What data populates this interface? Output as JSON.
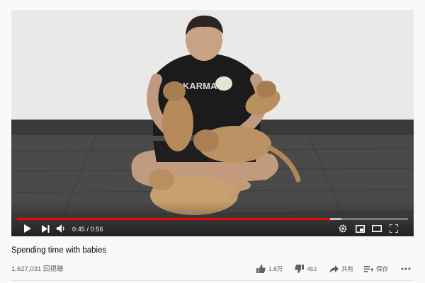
{
  "video": {
    "current_time": "0:45",
    "duration": "0:56",
    "time_separator": "/",
    "progress_fraction": 0.8,
    "buffer_fraction": 0.83,
    "accent_color": "#ff0000"
  },
  "info": {
    "title": "Spending time with babies",
    "views": "1,627,031 回視聴"
  },
  "actions": {
    "like_count": "1.8万",
    "dislike_count": "452",
    "share_label": "共有",
    "save_label": "保存"
  },
  "icons": [
    "play-icon",
    "next-icon",
    "volume-icon",
    "settings-icon",
    "miniplayer-icon",
    "theater-icon",
    "fullscreen-icon",
    "thumbs-up-icon",
    "thumbs-down-icon",
    "share-icon",
    "save-icon",
    "more-icon"
  ]
}
